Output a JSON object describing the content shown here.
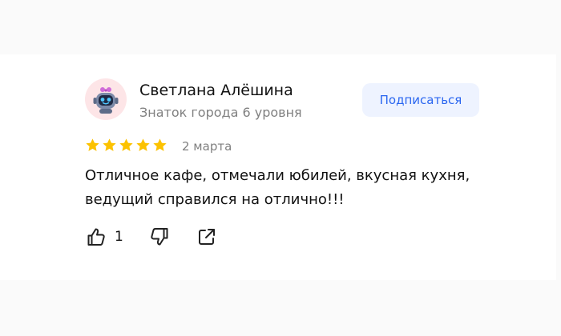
{
  "review": {
    "author_name": "Светлана Алёшина",
    "author_level": "Знаток города 6 уровня",
    "subscribe_label": "Подписаться",
    "rating": 5,
    "rating_max": 5,
    "date": "2 марта",
    "text": "Отличное кафе, отмечали юбилей, вкусная кухня, ведущий справился на отлично!!!",
    "likes": "1"
  },
  "colors": {
    "star": "#fcc200",
    "accent": "#2a66f0",
    "avatar_bg": "#fde5e7"
  },
  "icons": [
    "robot-avatar-icon",
    "star-icon",
    "thumbs-up-icon",
    "thumbs-down-icon",
    "share-icon"
  ]
}
